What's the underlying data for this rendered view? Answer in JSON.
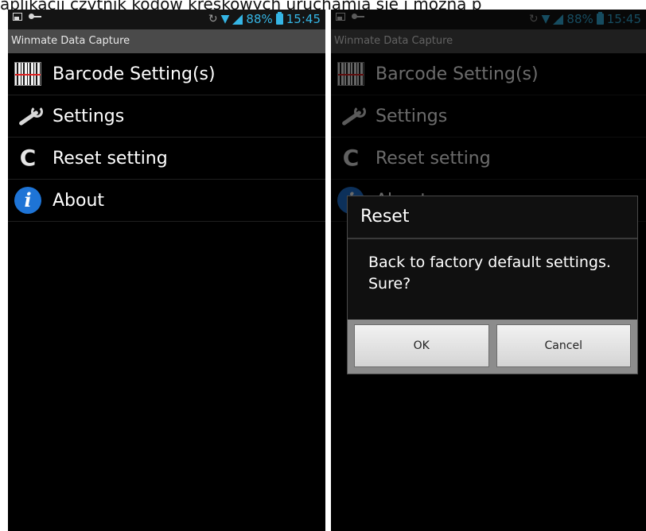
{
  "caption": "aplikacji czytnik kodów kreskowych uruchamia się i można p",
  "status_bar": {
    "battery_percent": "88%",
    "time": "15:45",
    "icons": [
      "image-icon",
      "key-icon",
      "sync-icon",
      "wifi-icon",
      "signal-icon",
      "battery-icon"
    ],
    "accent_color": "#35b5e5"
  },
  "app": {
    "title": "Winmate Data Capture",
    "menu": [
      {
        "label": "Barcode Setting(s)",
        "icon": "barcode-icon"
      },
      {
        "label": "Settings",
        "icon": "wrench-icon"
      },
      {
        "label": "Reset setting",
        "icon": "reset-icon"
      },
      {
        "label": "About",
        "icon": "info-icon"
      }
    ]
  },
  "dialog": {
    "title": "Reset",
    "message": "Back to factory default settings. Sure?",
    "ok_label": "OK",
    "cancel_label": "Cancel"
  }
}
